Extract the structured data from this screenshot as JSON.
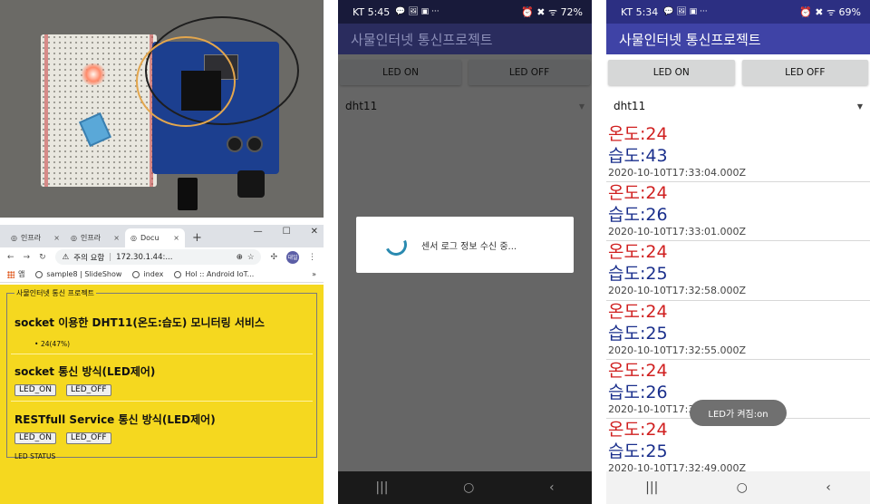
{
  "browser": {
    "tabs": [
      {
        "label": "인프라"
      },
      {
        "label": "인프라"
      },
      {
        "label": "Docu"
      }
    ],
    "window_controls": {
      "minimize": "—",
      "maximize": "☐",
      "close": "✕"
    },
    "tab_close": "×",
    "new_tab": "+",
    "address": {
      "security": "주의 요함",
      "url": "172.30.1.44:...",
      "profile_label": "대일"
    },
    "bookmarks": [
      {
        "label": "앱"
      },
      {
        "label": "sample8 | SlideShow"
      },
      {
        "label": "index"
      },
      {
        "label": "Hol :: Android IoT..."
      }
    ],
    "bookmarks_more": "»"
  },
  "webpage": {
    "legend": "사물인터넷 통신 프로젝트",
    "section1_title": "socket 이용한 DHT11(온도:습도) 모니터링 서비스",
    "section1_item": "24(47%)",
    "section2_title": "socket 통신 방식(LED제어)",
    "section3_title": "RESTfull Service 통신 방식(LED제어)",
    "btn_on": "LED_ON",
    "btn_off": "LED_OFF",
    "led_status": "LED STATUS"
  },
  "phone_loading": {
    "status_time": "KT 5:45",
    "status_icons": "💬 🖼 ▣ ···",
    "status_right": "⏰ ✖ ᯤ 72%",
    "app_title": "사물인터넷 통신프로젝트",
    "led_on": "LED ON",
    "led_off": "LED OFF",
    "spinner_value": "dht11",
    "dialog_text": "센서 로그 정보 수신 중...",
    "nav": {
      "recents": "|||",
      "home": "○",
      "back": "‹"
    }
  },
  "phone_list": {
    "status_time": "KT 5:34",
    "status_icons": "💬 🖼 ▣ ···",
    "status_right": "⏰ ✖ ᯤ 69%",
    "app_title": "사물인터넷 통신프로젝트",
    "led_on": "LED ON",
    "led_off": "LED OFF",
    "spinner_value": "dht11",
    "records": [
      {
        "temp": "온도:24",
        "hum": "습도:43",
        "ts": "2020-10-10T17:33:04.000Z"
      },
      {
        "temp": "온도:24",
        "hum": "습도:26",
        "ts": "2020-10-10T17:33:01.000Z"
      },
      {
        "temp": "온도:24",
        "hum": "습도:25",
        "ts": "2020-10-10T17:32:58.000Z"
      },
      {
        "temp": "온도:24",
        "hum": "습도:25",
        "ts": "2020-10-10T17:32:55.000Z"
      },
      {
        "temp": "온도:24",
        "hum": "습도:26",
        "ts": "2020-10-10T17:32:52.000Z"
      },
      {
        "temp": "온도:24",
        "hum": "습도:25",
        "ts": "2020-10-10T17:32:49.000Z"
      }
    ],
    "toast": "LED가 켜짐:on",
    "nav": {
      "recents": "|||",
      "home": "○",
      "back": "‹"
    }
  }
}
